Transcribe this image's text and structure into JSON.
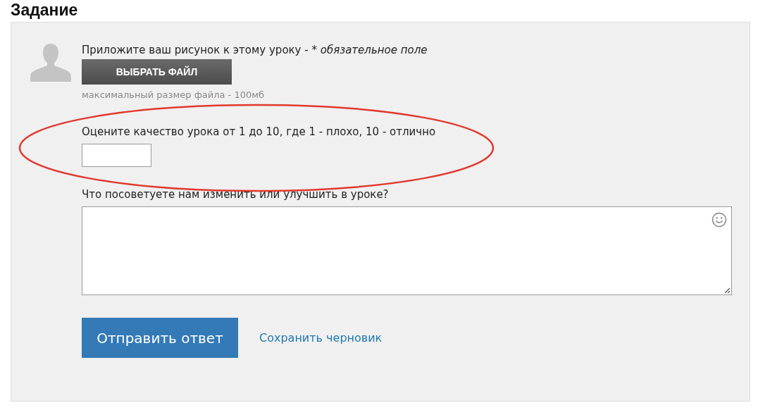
{
  "heading": "Задание",
  "form": {
    "attach": {
      "label": "Приложите ваш рисунок к этому уроку - * ",
      "required_note": "обязательное поле",
      "button": "ВЫБРАТЬ ФАЙЛ",
      "note": "максимальный размер файла - 100мб"
    },
    "rating": {
      "label": "Оцените качество урока от 1 до 10, где 1 - плохо, 10 - отлично"
    },
    "advice": {
      "label": "Что посоветуете нам изменить или улучшить в уроке?"
    },
    "submit": "Отправить ответ",
    "save_draft": "Сохранить черновик"
  },
  "highlight": {
    "kind": "ellipse",
    "color": "#e0382e"
  }
}
